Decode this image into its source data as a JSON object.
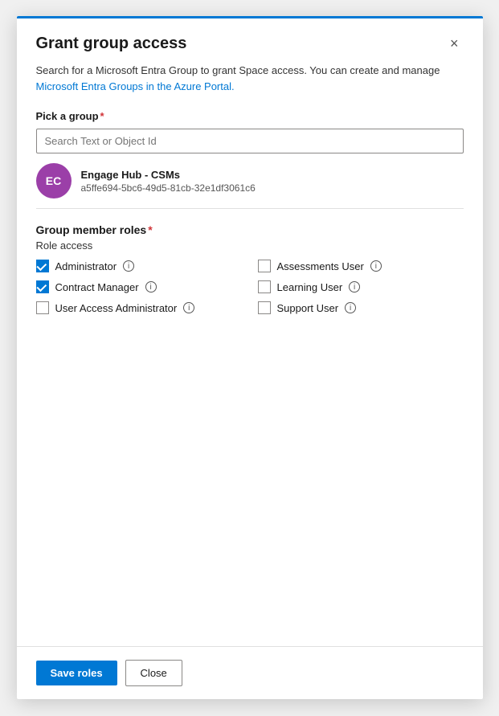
{
  "modal": {
    "title": "Grant group access",
    "close_label": "×"
  },
  "description": {
    "text": "Search for a Microsoft Entra Group to grant Space access. You can create and manage",
    "link_text": "Microsoft Entra Groups in the Azure Portal.",
    "link_href": "#"
  },
  "pick_group": {
    "label": "Pick a group",
    "required": "*",
    "search_placeholder": "Search Text or Object Id"
  },
  "selected_group": {
    "initials": "EC",
    "name": "Engage Hub - CSMs",
    "id": "a5ffe694-5bc6-49d5-81cb-32e1df3061c6"
  },
  "roles_section": {
    "title": "Group member roles",
    "required": "*",
    "role_access_label": "Role access",
    "roles": [
      {
        "id": "administrator",
        "label": "Administrator",
        "checked": true,
        "col": 0
      },
      {
        "id": "assessments-user",
        "label": "Assessments User",
        "checked": false,
        "col": 1
      },
      {
        "id": "contract-manager",
        "label": "Contract Manager",
        "checked": true,
        "col": 0
      },
      {
        "id": "learning-user",
        "label": "Learning User",
        "checked": false,
        "col": 1
      },
      {
        "id": "user-access-admin",
        "label": "User Access Administrator",
        "checked": false,
        "col": 0
      },
      {
        "id": "support-user",
        "label": "Support User",
        "checked": false,
        "col": 1
      }
    ]
  },
  "footer": {
    "save_label": "Save roles",
    "close_label": "Close"
  }
}
